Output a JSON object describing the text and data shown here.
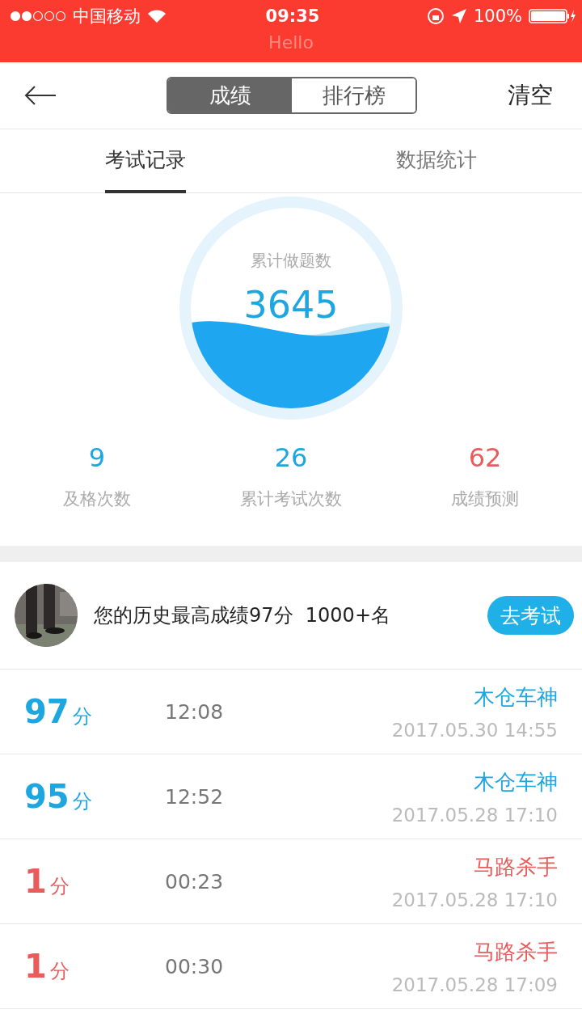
{
  "status_bar": {
    "carrier": "中国移动",
    "time": "09:35",
    "battery": "100%"
  },
  "header": {
    "subtitle": "Hello"
  },
  "nav": {
    "segments": [
      {
        "label": "成绩",
        "selected": true
      },
      {
        "label": "排行榜",
        "selected": false
      }
    ],
    "action": "清空"
  },
  "tabs": [
    {
      "label": "考试记录",
      "selected": true
    },
    {
      "label": "数据统计",
      "selected": false
    }
  ],
  "summary": {
    "label": "累计做题数",
    "value": "3645"
  },
  "stats": [
    {
      "value": "9",
      "label": "及格次数",
      "color": "#1ea6e0"
    },
    {
      "value": "26",
      "label": "累计考试次数",
      "color": "#1ea6e0"
    },
    {
      "value": "62",
      "label": "成绩预测",
      "color": "#e85c5c"
    }
  ],
  "profile": {
    "text": "您的历史最高成绩97分  1000+名",
    "button": "去考试"
  },
  "records": [
    {
      "score": "97",
      "unit": "分",
      "duration": "12:08",
      "title": "木仓车神",
      "date": "2017.05.30 14:55",
      "passed": true
    },
    {
      "score": "95",
      "unit": "分",
      "duration": "12:52",
      "title": "木仓车神",
      "date": "2017.05.28 17:10",
      "passed": true
    },
    {
      "score": "1",
      "unit": "分",
      "duration": "00:23",
      "title": "马路杀手",
      "date": "2017.05.28 17:10",
      "passed": false
    },
    {
      "score": "1",
      "unit": "分",
      "duration": "00:30",
      "title": "马路杀手",
      "date": "2017.05.28 17:09",
      "passed": false
    }
  ]
}
